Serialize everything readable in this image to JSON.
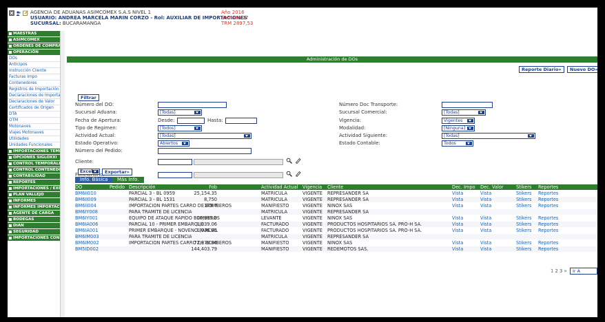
{
  "header": {
    "line1": "AGENCIA DE ADUANAS ASIMCOMEX S.A.S NIVEL 1",
    "line2_label": "USUARIO:",
    "line2_value": "ANDREA MARCELA MARIN CORZO - Rol: AUXILIAR DE IMPORTACIONES",
    "line3_label": "SUCURSAL:",
    "line3_value": "BUCARAMANGA",
    "year": "Año 2016",
    "week": "Semana 27",
    "trm": "TRM 2897,53"
  },
  "sidebar": [
    {
      "type": "group",
      "label": "MAESTRAS"
    },
    {
      "type": "group",
      "label": "ASIMCOMEX"
    },
    {
      "type": "group",
      "label": "ORDENES DE COMPRA"
    },
    {
      "type": "group",
      "label": "OPERACIÓN"
    },
    {
      "type": "item",
      "label": "DOs"
    },
    {
      "type": "item",
      "label": "Anticipos"
    },
    {
      "type": "item",
      "label": "Instrucción Cliente"
    },
    {
      "type": "item",
      "label": "Facturas Impo"
    },
    {
      "type": "item",
      "label": "Contenedores"
    },
    {
      "type": "item",
      "label": "Registros de Importación"
    },
    {
      "type": "item",
      "label": "Declaraciones de Importación"
    },
    {
      "type": "item",
      "label": "Declaraciones de Valor"
    },
    {
      "type": "item",
      "label": "Certificados de Origen"
    },
    {
      "type": "item",
      "label": "DTA"
    },
    {
      "type": "item",
      "label": "OTM"
    },
    {
      "type": "item",
      "label": "Motonaves"
    },
    {
      "type": "item",
      "label": "Viajes Motonaves"
    },
    {
      "type": "item",
      "label": "Utilidades"
    },
    {
      "type": "item",
      "label": "Unidades Funcionales"
    },
    {
      "type": "group",
      "label": "IMPORTACIONES TEMPORALES"
    },
    {
      "type": "group",
      "label": "OPCIONES SIGLOXXI"
    },
    {
      "type": "group",
      "label": "CONTROL TEMPORALES"
    },
    {
      "type": "group",
      "label": "CONTROL CONTENEDORES"
    },
    {
      "type": "group",
      "label": "CONTABILIDAD"
    },
    {
      "type": "group",
      "label": "REPORTES"
    },
    {
      "type": "group",
      "label": "IMPORTACIONES / EXPORTACIONES"
    },
    {
      "type": "group",
      "label": "PLAN VALLEJO"
    },
    {
      "type": "group",
      "label": "INFORMES"
    },
    {
      "type": "group",
      "label": "INFORMES IMPORTACIONES"
    },
    {
      "type": "group",
      "label": "AGENTE DE CARGA"
    },
    {
      "type": "group",
      "label": "BODEGAS"
    },
    {
      "type": "group",
      "label": "DIAN"
    },
    {
      "type": "group",
      "label": "SEGURIDAD"
    },
    {
      "type": "group",
      "label": "IMPORTACIONES CONSOLIDADO"
    }
  ],
  "panel": {
    "title": "Administración de DOs",
    "reporte_diario": "Reporte Diario»",
    "nuevo_do": "Nuevo DO»",
    "filtrar": "Filtrar"
  },
  "filters": {
    "numero_do": "Número del DO:",
    "sucursal_aduana": "Sucursal Aduana:",
    "sucursal_aduana_val": "[Todas]",
    "fecha_apertura": "Fecha de Apertura:",
    "desde": "Desde:",
    "hasta": "Hasta:",
    "tipo_regimen": "Tipo de Regimen:",
    "tipo_regimen_val": "[Todos]",
    "actividad_actual": "Actividad Actual:",
    "actividad_actual_val": "[Todas]",
    "estado_operativo": "Estado Operativo:",
    "estado_operativo_val": "Abiertos",
    "numero_pedido": "Número del Pedido:",
    "cliente": "Cliente:",
    "funcionario": "Funcionario:",
    "numero_doc_transporte": "Número Doc Transporte:",
    "sucursal_comercial": "Sucursal Comercial:",
    "sucursal_comercial_val": "[Todas]",
    "vigencia": "Vigencia:",
    "vigencia_val": "Vigentes",
    "modalidad": "Modalidad:",
    "modalidad_val": "[Ninguna]",
    "actividad_siguiente": "Actividad Siguiente:",
    "actividad_siguiente_val": "[Todas]",
    "estado_contable": "Estado Contable:",
    "estado_contable_val": "Todos"
  },
  "export": {
    "format": "Excel",
    "button": "Exportar»"
  },
  "tabs": [
    "Info. Básica",
    "Más Info."
  ],
  "table": {
    "headers": [
      "DO",
      "Pedido",
      "Descripción",
      "Fob",
      "Actividad Actual",
      "Vigencia",
      "Cliente",
      "Dec. Impo",
      "Dec. Valor",
      "Stikers",
      "Reportes"
    ],
    "rows": [
      [
        "BM6II010",
        "",
        "PARCIAL 3 - BL 0959",
        "25,154.35",
        "MATRICULA",
        "VIGENTE",
        "REPRESANDER SA",
        "Vista",
        "Vista",
        "Stikers",
        "Reportes"
      ],
      [
        "BM6II009",
        "",
        "PARCIAL 3 - BL 1531",
        "8,750",
        "MATRICULA",
        "VIGENTE",
        "REPRESANDER SA",
        "Vista",
        "Vista",
        "Stikers",
        "Reportes"
      ],
      [
        "BM6II004",
        "",
        "IMPORTACION PARTES CARRO DE BOMBEROS",
        "179.7",
        "MANIFIESTO",
        "VIGENTE",
        "NINOX SAS",
        "Vista",
        "Vista",
        "Stikers",
        "Reportes"
      ],
      [
        "BM6IY008",
        "",
        "PARA TRAMITE DE LICENCIA",
        "",
        "MATRICULA",
        "VIGENTE",
        "REPRESANDER SA",
        "",
        "",
        "",
        ""
      ],
      [
        "BM6IY001",
        "",
        "EQUIPO DE ATAQUE RÁPIDO BOMBEROS",
        "10,995.8",
        "LEVANTE",
        "VIGENTE",
        "NINOX SAS",
        "Vista",
        "Vista",
        "Stikers",
        "Reportes"
      ],
      [
        "BM6IA006",
        "",
        "PARCIAL 10 - PRIMER EMBARQUE",
        "1,039.06",
        "FACTURADO",
        "VIGENTE",
        "PRODUCTOS HOSPITARIOS SA. PRO-H SA.",
        "Vista",
        "Vista",
        "Stikers",
        "Reportes"
      ],
      [
        "BM6IA001",
        "",
        "PRIMER EMBARQUE - NOVENO PARCIAL",
        "1,036.85",
        "FACTURADO",
        "VIGENTE",
        "PRODUCTOS HOSPITARIOS SA. PRO-H SA.",
        "Vista",
        "Vista",
        "Stikers",
        "Reportes"
      ],
      [
        "BM6IM003",
        "",
        "PARA TRAMITE DE LICENCIA",
        "",
        "MATRICULA",
        "VIGENTE",
        "REPRESANDER SA",
        "",
        "",
        "",
        ""
      ],
      [
        "BM6IM002",
        "",
        "IMPORTACION PARTES CARRO DE BOMBEROS",
        "72,979.36",
        "MANIFIESTO",
        "VIGENTE",
        "NINOX SAS",
        "Vista",
        "Vista",
        "Stikers",
        "Reportes"
      ],
      [
        "BM5ID002",
        "",
        "",
        "144,403.79",
        "MANIFIESTO",
        "VIGENTE",
        "REDEMOTOS SAS.",
        "Vista",
        "Vista",
        "Stikers",
        "Reportes"
      ]
    ]
  },
  "pagination": {
    "current": "1",
    "others": "2 3 »",
    "go": "Ir A"
  },
  "colors": {
    "green": "#2f7d2f",
    "navy": "#1a3d8c",
    "link": "#1d5fb0",
    "red": "#e03020"
  }
}
